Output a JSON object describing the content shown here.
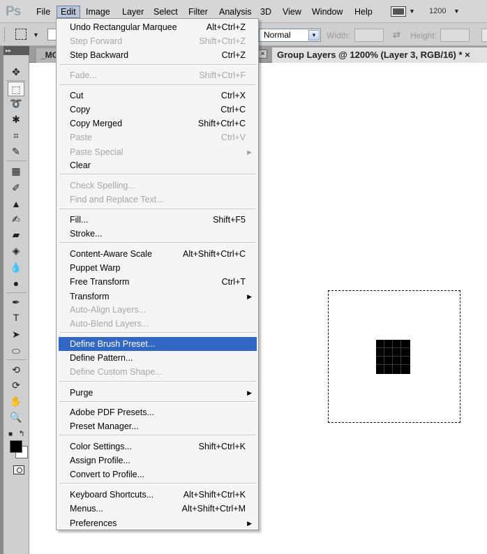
{
  "app": {
    "logo": "Ps"
  },
  "menubar": {
    "items": [
      "File",
      "Edit",
      "Image",
      "Layer",
      "Select",
      "Filter",
      "Analysis",
      "3D",
      "View",
      "Window",
      "Help"
    ],
    "zoom": "1200"
  },
  "options": {
    "style_value": "Normal",
    "width_label": "Width:",
    "height_label": "Height:"
  },
  "tabs": [
    {
      "label": "_MG"
    },
    {
      "label": "Group Layers @ 1200% (Layer 3, RGB/16) * ×"
    }
  ],
  "edit_menu": {
    "items": [
      {
        "label": "Undo Rectangular Marquee",
        "shortcut": "Alt+Ctrl+Z"
      },
      {
        "label": "Step Forward",
        "shortcut": "Shift+Ctrl+Z"
      },
      {
        "label": "Step Backward",
        "shortcut": "Ctrl+Z"
      },
      {
        "label": "Fade...",
        "shortcut": "Shift+Ctrl+F"
      },
      {
        "label": "Cut",
        "shortcut": "Ctrl+X"
      },
      {
        "label": "Copy",
        "shortcut": "Ctrl+C"
      },
      {
        "label": "Copy Merged",
        "shortcut": "Shift+Ctrl+C"
      },
      {
        "label": "Paste",
        "shortcut": "Ctrl+V"
      },
      {
        "label": "Paste Special",
        "shortcut": ""
      },
      {
        "label": "Clear",
        "shortcut": ""
      },
      {
        "label": "Check Spelling...",
        "shortcut": ""
      },
      {
        "label": "Find and Replace Text...",
        "shortcut": ""
      },
      {
        "label": "Fill...",
        "shortcut": "Shift+F5"
      },
      {
        "label": "Stroke...",
        "shortcut": ""
      },
      {
        "label": "Content-Aware Scale",
        "shortcut": "Alt+Shift+Ctrl+C"
      },
      {
        "label": "Puppet Warp",
        "shortcut": ""
      },
      {
        "label": "Free Transform",
        "shortcut": "Ctrl+T"
      },
      {
        "label": "Transform",
        "shortcut": ""
      },
      {
        "label": "Auto-Align Layers...",
        "shortcut": ""
      },
      {
        "label": "Auto-Blend Layers...",
        "shortcut": ""
      },
      {
        "label": "Define Brush Preset...",
        "shortcut": ""
      },
      {
        "label": "Define Pattern...",
        "shortcut": ""
      },
      {
        "label": "Define Custom Shape...",
        "shortcut": ""
      },
      {
        "label": "Purge",
        "shortcut": ""
      },
      {
        "label": "Adobe PDF Presets...",
        "shortcut": ""
      },
      {
        "label": "Preset Manager...",
        "shortcut": ""
      },
      {
        "label": "Color Settings...",
        "shortcut": "Shift+Ctrl+K"
      },
      {
        "label": "Assign Profile...",
        "shortcut": ""
      },
      {
        "label": "Convert to Profile...",
        "shortcut": ""
      },
      {
        "label": "Keyboard Shortcuts...",
        "shortcut": "Alt+Shift+Ctrl+K"
      },
      {
        "label": "Menus...",
        "shortcut": "Alt+Shift+Ctrl+M"
      },
      {
        "label": "Preferences",
        "shortcut": ""
      }
    ]
  },
  "colors": {
    "menu_highlight": "#3367c6",
    "disabled_text": "#a6a6a6",
    "foreground_swatch": "#000000",
    "background_swatch": "#ffffff"
  }
}
